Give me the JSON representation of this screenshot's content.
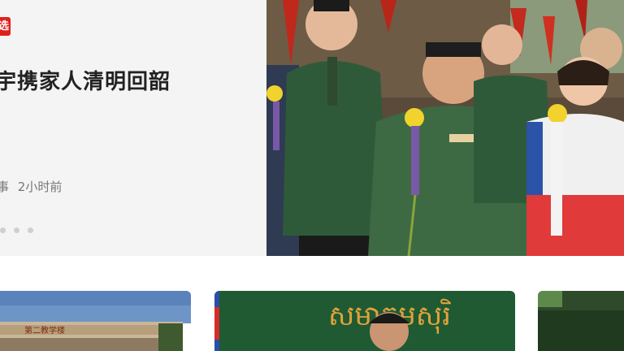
{
  "hero": {
    "badge": "选",
    "title": "宇携家人清明回韶",
    "meta_source": "事",
    "meta_time": "2小时前",
    "pagination_count": 3
  },
  "cards": [
    {
      "image": "campus-building-photo",
      "sign_text": "第二教学楼"
    },
    {
      "image": "cambodian-official-portrait",
      "banner_text": "សមាគមសុរិ"
    },
    {
      "image": "green-field-photo"
    }
  ],
  "colors": {
    "badge": "#e0201b",
    "panel": "#f4f4f4"
  }
}
